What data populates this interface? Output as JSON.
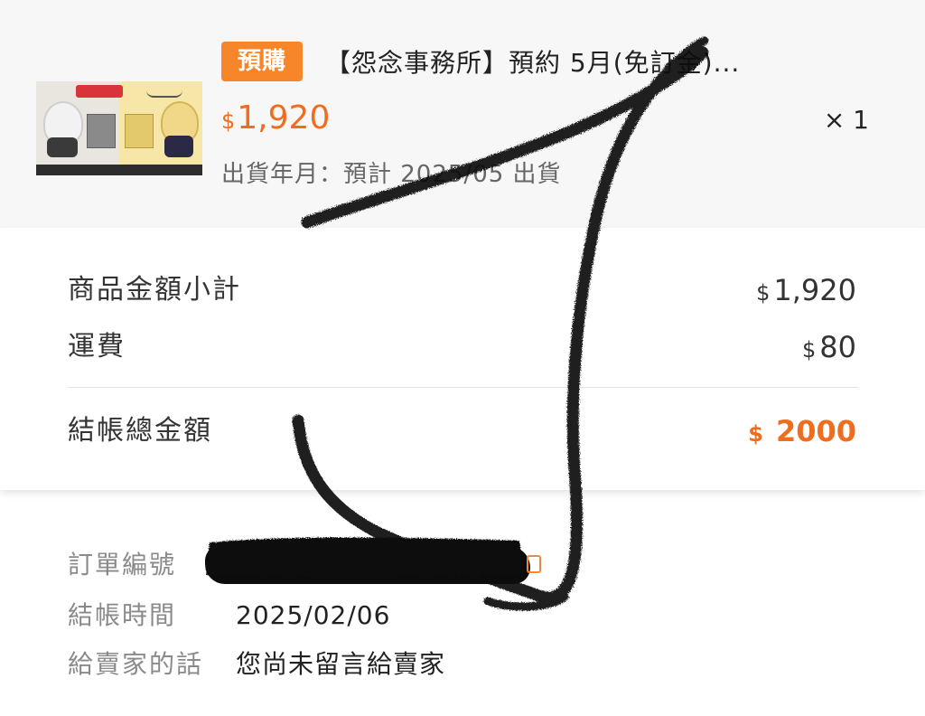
{
  "product": {
    "thumbnail": "product-thumbnail-image",
    "badge": "預購",
    "title": "【怨念事務所】預約 5月(免訂金)...",
    "price_currency": "$",
    "price_amount": "1,920",
    "quantity": "× 1",
    "ship_date": "出貨年月：預計 2025/05 出貨"
  },
  "summary": {
    "subtotal": {
      "label": "商品金額小計",
      "currency": "$",
      "amount": "1,920"
    },
    "shipping": {
      "label": "運費",
      "currency": "$",
      "amount": "80"
    },
    "total": {
      "label": "結帳總金額",
      "currency": "$",
      "amount": "2000"
    }
  },
  "order_info": {
    "order_number_label": "訂單編號",
    "checkout_time_label": "結帳時間",
    "checkout_time": "2025/02/06",
    "message_label": "給賣家的話",
    "message": "您尚未留言給賣家"
  },
  "colors": {
    "accent": "#ee6d1f",
    "badge_bg": "#f7852a",
    "card_bg": "#f7f7f7",
    "scribble": "#111111"
  },
  "icons": {
    "copy": "copy-icon"
  }
}
